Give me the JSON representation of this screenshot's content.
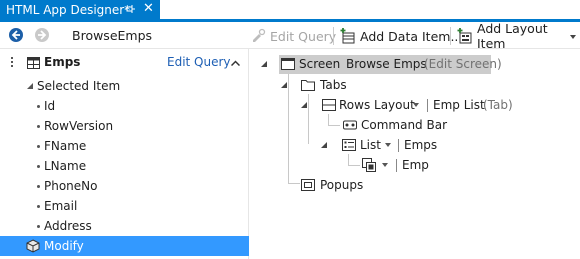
{
  "document_tab": {
    "title": "HTML App Designer*",
    "pin_icon": "pin-icon",
    "close_glyph": "✕"
  },
  "toolbar": {
    "screen_name": "BrowseEmps",
    "edit_query": "Edit Query",
    "add_data_item": "Add Data Item...",
    "add_layout_item": "Add Layout Item"
  },
  "left_panel": {
    "entity_name": "Emps",
    "edit_query_link": "Edit Query",
    "selected_item_label": "Selected Item",
    "fields": [
      "Id",
      "RowVersion",
      "FName",
      "LName",
      "PhoneNo",
      "Email",
      "Address"
    ],
    "method": "Modify"
  },
  "tree": {
    "screen_label": "Screen",
    "screen_name": "Browse Emps",
    "screen_edit": "(Edit Screen)",
    "tabs": "Tabs",
    "rows_layout": "Rows Layout",
    "rows_layout_name": "Emp List",
    "rows_layout_suffix": "(Tab)",
    "command_bar": "Command Bar",
    "list_label": "List",
    "list_source": "Emps",
    "item_source": "Emp",
    "popups": "Popups"
  },
  "colors": {
    "accent": "#007acc",
    "selection": "#3399ff",
    "link": "#1e5fb4",
    "tree_selection": "#cccccc"
  }
}
